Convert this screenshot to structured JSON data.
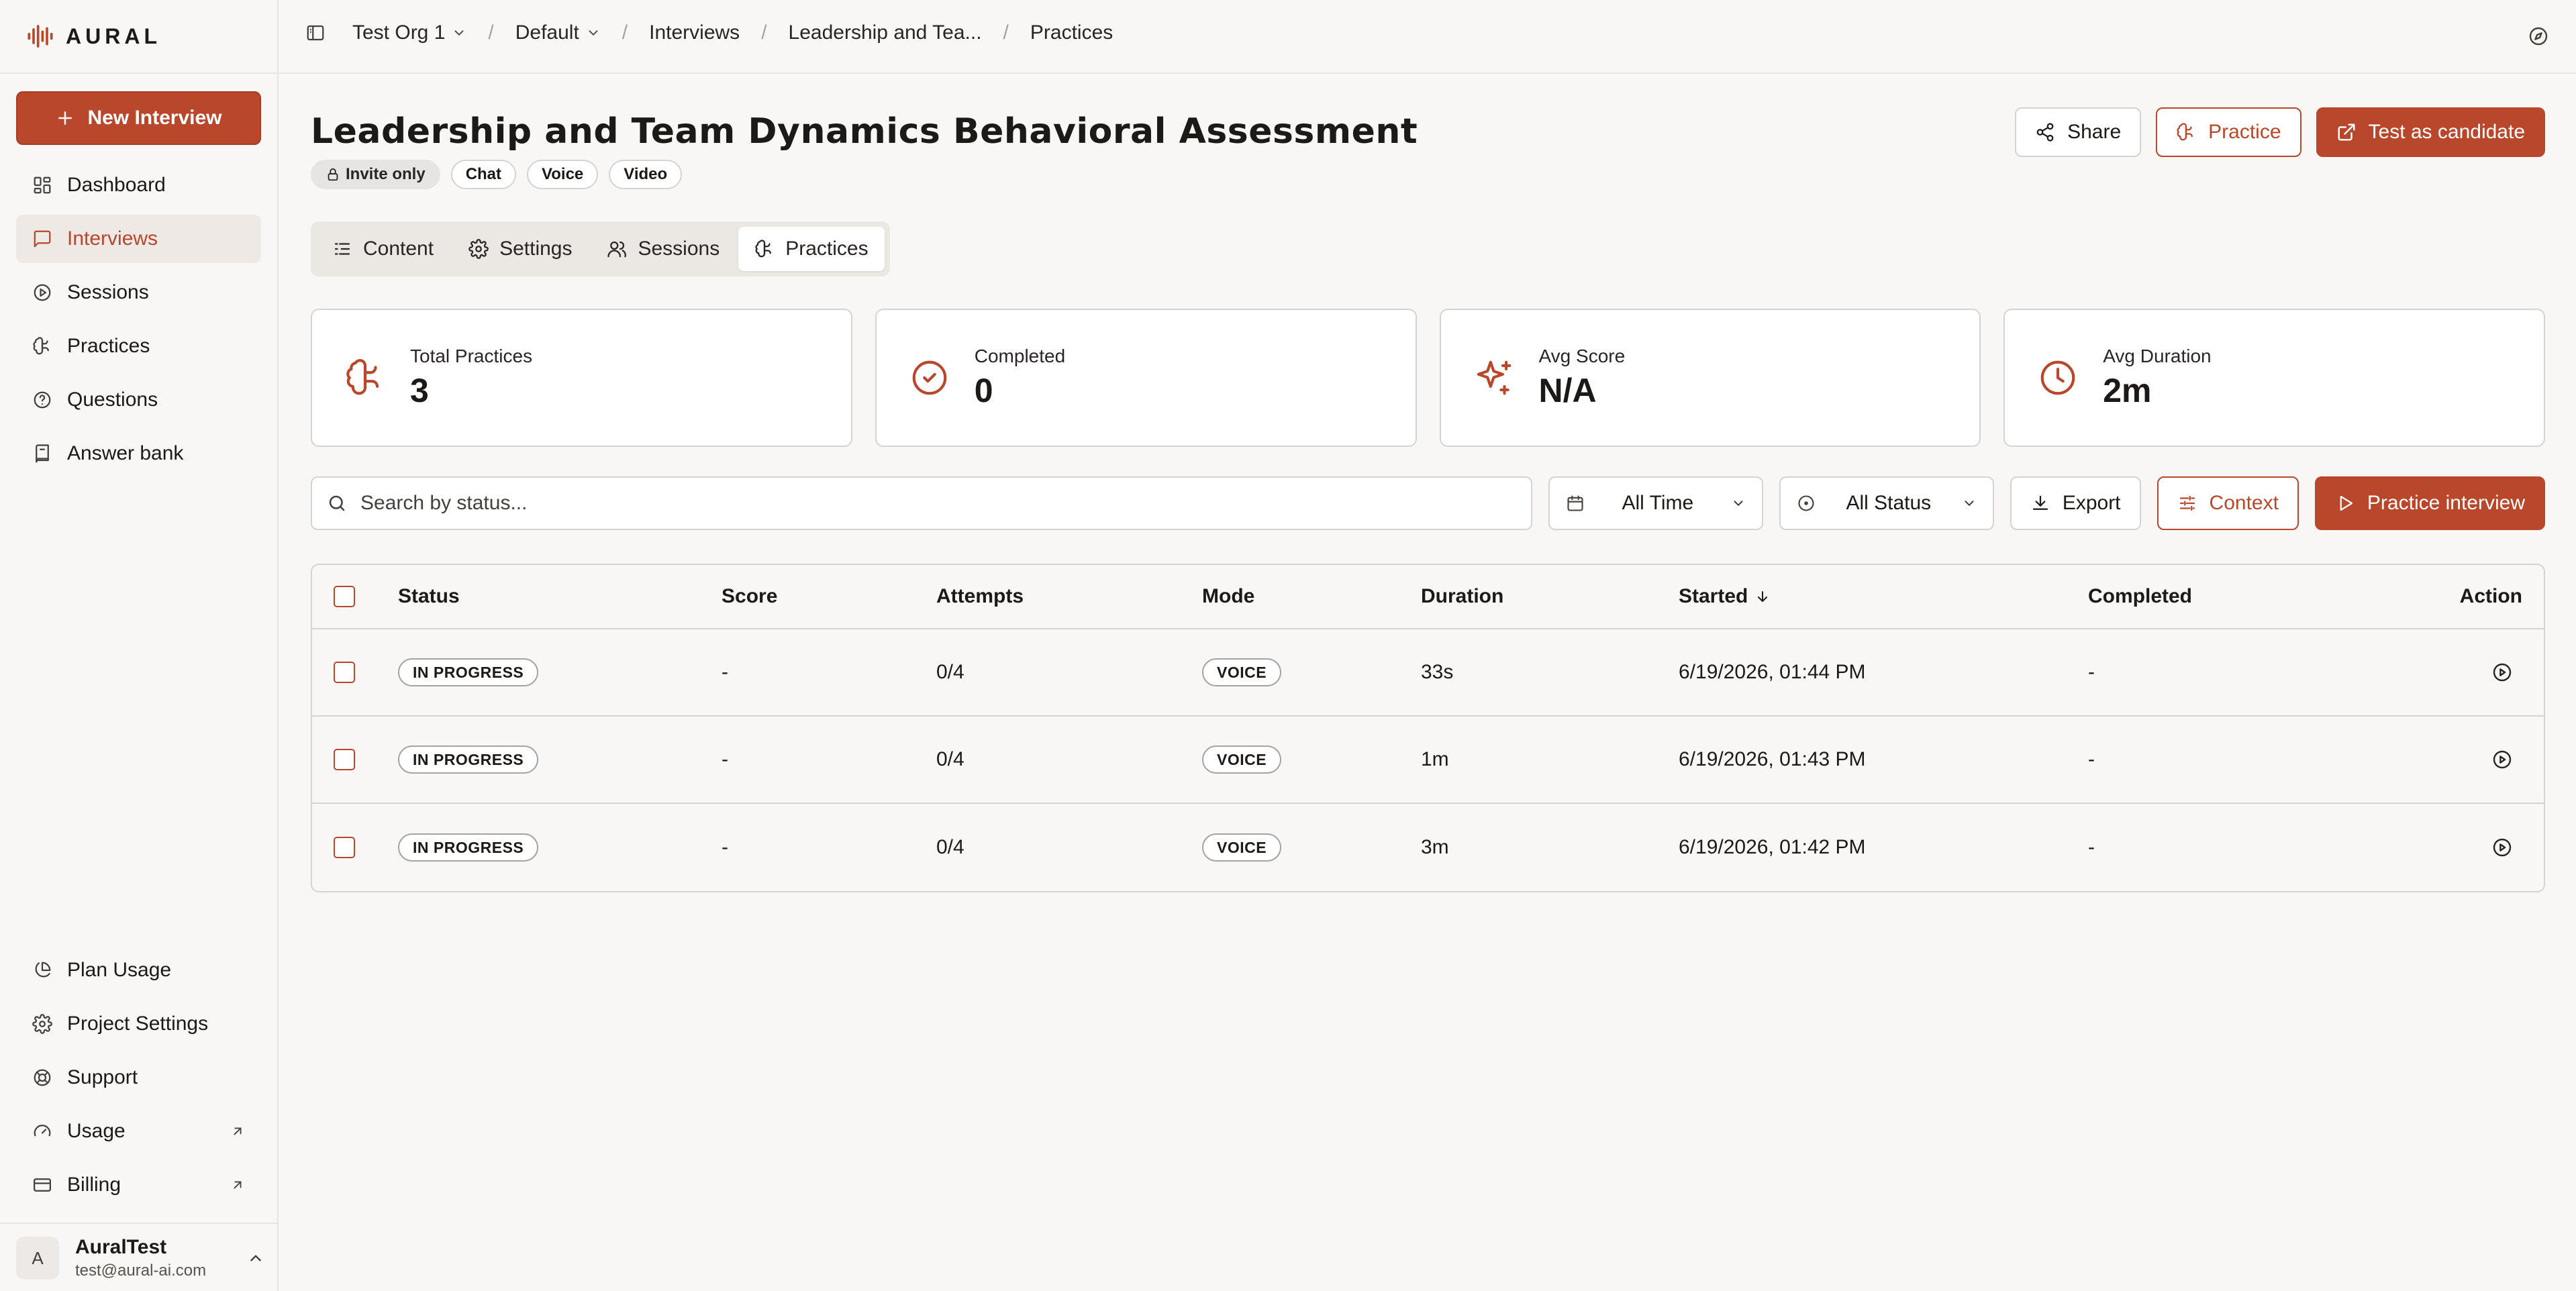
{
  "app": {
    "brand": "AURAL"
  },
  "sidebar": {
    "new_button": "New Interview",
    "nav": [
      {
        "label": "Dashboard",
        "icon": "dashboard-icon",
        "active": false
      },
      {
        "label": "Interviews",
        "icon": "message-square-icon",
        "active": true
      },
      {
        "label": "Sessions",
        "icon": "circle-play-icon",
        "active": false
      },
      {
        "label": "Practices",
        "icon": "brain-icon",
        "active": false
      },
      {
        "label": "Questions",
        "icon": "help-circle-icon",
        "active": false
      },
      {
        "label": "Answer bank",
        "icon": "book-icon",
        "active": false
      }
    ],
    "bottom_nav": [
      {
        "label": "Plan Usage",
        "icon": "pie-chart-icon",
        "external": false
      },
      {
        "label": "Project Settings",
        "icon": "gear-icon",
        "external": false
      },
      {
        "label": "Support",
        "icon": "life-buoy-icon",
        "external": false
      },
      {
        "label": "Usage",
        "icon": "gauge-icon",
        "external": true
      },
      {
        "label": "Billing",
        "icon": "credit-card-icon",
        "external": true
      }
    ],
    "user": {
      "initial": "A",
      "name": "AuralTest",
      "email": "test@aural-ai.com"
    }
  },
  "breadcrumb": {
    "org": "Test Org 1",
    "project": "Default",
    "section": "Interviews",
    "interview": "Leadership and Tea...",
    "page": "Practices"
  },
  "header": {
    "title": "Leadership and Team Dynamics Behavioral Assessment",
    "tags": {
      "invite": "Invite only",
      "chat": "Chat",
      "voice": "Voice",
      "video": "Video"
    },
    "share": "Share",
    "practice": "Practice",
    "test_candidate": "Test as candidate"
  },
  "tabs": {
    "content": "Content",
    "settings": "Settings",
    "sessions": "Sessions",
    "practices": "Practices",
    "active": "Practices"
  },
  "stats": {
    "total": {
      "label": "Total Practices",
      "value": "3"
    },
    "completed": {
      "label": "Completed",
      "value": "0"
    },
    "avg_score": {
      "label": "Avg Score",
      "value": "N/A"
    },
    "avg_duration": {
      "label": "Avg Duration",
      "value": "2m"
    }
  },
  "filters": {
    "search_placeholder": "Search by status...",
    "time": "All Time",
    "status": "All Status",
    "export": "Export",
    "context": "Context",
    "practice_interview": "Practice interview"
  },
  "table": {
    "headers": {
      "status": "Status",
      "score": "Score",
      "attempts": "Attempts",
      "mode": "Mode",
      "duration": "Duration",
      "started": "Started",
      "completed": "Completed",
      "action": "Action"
    },
    "rows": [
      {
        "status": "IN PROGRESS",
        "score": "-",
        "attempts": "0/4",
        "mode": "VOICE",
        "duration": "33s",
        "started": "6/19/2026, 01:44 PM",
        "completed": "-"
      },
      {
        "status": "IN PROGRESS",
        "score": "-",
        "attempts": "0/4",
        "mode": "VOICE",
        "duration": "1m",
        "started": "6/19/2026, 01:43 PM",
        "completed": "-"
      },
      {
        "status": "IN PROGRESS",
        "score": "-",
        "attempts": "0/4",
        "mode": "VOICE",
        "duration": "3m",
        "started": "6/19/2026, 01:42 PM",
        "completed": "-"
      }
    ]
  },
  "colors": {
    "accent": "#b9472b",
    "background": "#f8f7f5",
    "border": "#d6d3d1"
  }
}
